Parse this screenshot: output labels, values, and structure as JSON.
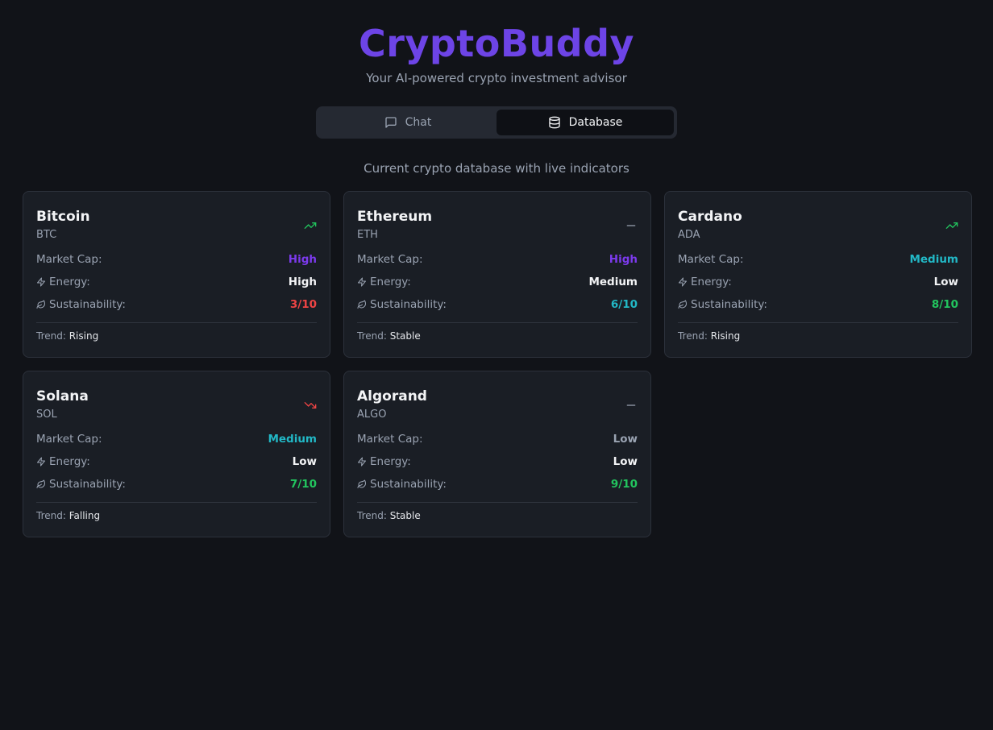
{
  "app": {
    "title": "CryptoBuddy",
    "subtitle": "Your AI-powered crypto investment advisor"
  },
  "tabs": [
    {
      "label": "Chat",
      "icon": "message-square-icon",
      "active": false
    },
    {
      "label": "Database",
      "icon": "database-icon",
      "active": true
    }
  ],
  "caption": "Current crypto database with live indicators",
  "labels": {
    "market_cap": "Market Cap:",
    "energy": "Energy:",
    "sustainability": "Sustainability:",
    "trend": "Trend:"
  },
  "colors": {
    "brand": "#6d44e6",
    "high": "#7c3aed",
    "medium": "#22b8c6",
    "low_cap": "#9aa3b2",
    "rising": "#22c55e",
    "falling": "#ef4444",
    "stable": "#9aa3b2"
  },
  "coins": [
    {
      "name": "Bitcoin",
      "symbol": "BTC",
      "market_cap": "High",
      "energy": "High",
      "sustainability": "3/10",
      "trend": "Rising",
      "trend_icon": "trending-up-icon"
    },
    {
      "name": "Ethereum",
      "symbol": "ETH",
      "market_cap": "High",
      "energy": "Medium",
      "sustainability": "6/10",
      "trend": "Stable",
      "trend_icon": "minus-icon"
    },
    {
      "name": "Cardano",
      "symbol": "ADA",
      "market_cap": "Medium",
      "energy": "Low",
      "sustainability": "8/10",
      "trend": "Rising",
      "trend_icon": "trending-up-icon"
    },
    {
      "name": "Solana",
      "symbol": "SOL",
      "market_cap": "Medium",
      "energy": "Low",
      "sustainability": "7/10",
      "trend": "Falling",
      "trend_icon": "trending-down-icon"
    },
    {
      "name": "Algorand",
      "symbol": "ALGO",
      "market_cap": "Low",
      "energy": "Low",
      "sustainability": "9/10",
      "trend": "Stable",
      "trend_icon": "minus-icon"
    }
  ]
}
